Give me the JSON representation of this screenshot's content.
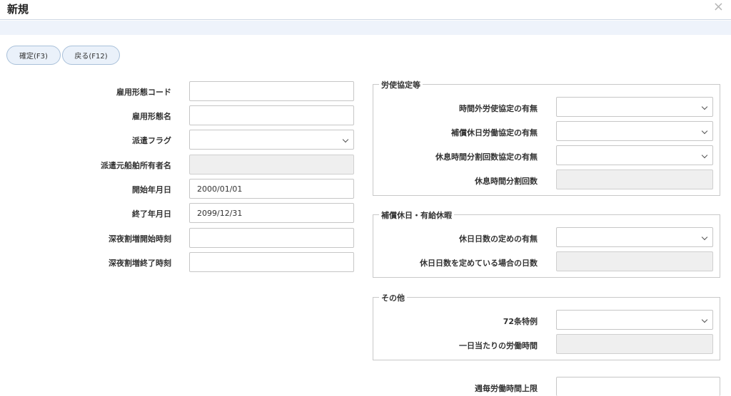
{
  "window": {
    "title": "新規",
    "close_glyph": "×"
  },
  "toolbar": {
    "confirm_label": "確定(F3)",
    "back_label": "戻る(F12)"
  },
  "left": {
    "employment_code_label": "雇用形態コード",
    "employment_name_label": "雇用形態名",
    "dispatch_flag_label": "派遣フラグ",
    "dispatch_owner_label": "派遣元船舶所有者名",
    "start_date_label": "開始年月日",
    "start_date_value": "2000/01/01",
    "end_date_label": "終了年月日",
    "end_date_value": "2099/12/31",
    "night_start_label": "深夜割増開始時刻",
    "night_end_label": "深夜割増終了時刻"
  },
  "labor_agreement": {
    "legend": "労使協定等",
    "overtime_label": "時間外労使協定の有無",
    "comp_holiday_label": "補償休日労働協定の有無",
    "break_split_label": "休息時間分割回数協定の有無",
    "break_split_count_label": "休息時間分割回数"
  },
  "holidays": {
    "legend": "補償休日・有給休暇",
    "holiday_days_rule_label": "休日日数の定めの有無",
    "holiday_days_label": "休日日数を定めている場合の日数"
  },
  "other": {
    "legend": "その他",
    "article72_label": "72条特例",
    "daily_hours_label": "一日当たりの労働時間"
  },
  "weekly_limit_label": "週毎労働時間上限"
}
